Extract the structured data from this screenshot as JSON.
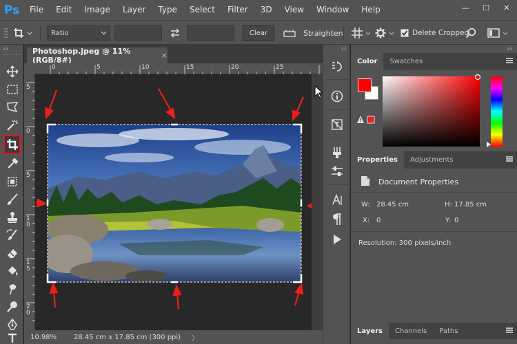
{
  "app": {
    "logo": "Ps"
  },
  "menu": [
    "File",
    "Edit",
    "Image",
    "Layer",
    "Type",
    "Select",
    "Filter",
    "3D",
    "View",
    "Window",
    "Help"
  ],
  "window_controls": {
    "minimize": "—",
    "maximize": "☐",
    "close": "✕"
  },
  "options_bar": {
    "ratio_label": "Ratio",
    "clear_label": "Clear",
    "straighten_label": "Straighten",
    "delete_cropped_label": "Delete Cropped",
    "delete_cropped_checked": true
  },
  "document": {
    "tab_title": "Photoshop.jpeg @ 11% (RGB/8#)",
    "tab_close": "×",
    "ruler_h_labels": [
      "0",
      "5",
      "10",
      "15",
      "20",
      "25"
    ],
    "ruler_v_labels": [
      "5",
      "0",
      "5",
      "1 0",
      "1 5",
      "2 0"
    ]
  },
  "status": {
    "zoom": "10.98%",
    "doc_info": "28.45 cm x 17.85 cm (300 ppi)",
    "arrow": "〉"
  },
  "color_panel": {
    "tabs": [
      "Color",
      "Swatches"
    ],
    "active_tab": "Color",
    "foreground": "#ff0000",
    "background": "#ffffff"
  },
  "properties_panel": {
    "tabs": [
      "Properties",
      "Adjustments"
    ],
    "active_tab": "Properties",
    "title": "Document Properties",
    "w_label": "W:",
    "w_value": "28.45 cm",
    "h_label": "H:",
    "h_value": "17.85 cm",
    "x_label": "X:",
    "x_value": "0",
    "y_label": "Y:",
    "y_value": "0",
    "resolution": "Resolution: 300 pixels/inch"
  },
  "layers_panel": {
    "tabs": [
      "Layers",
      "Channels",
      "Paths"
    ],
    "active_tab": "Layers"
  },
  "colors": {
    "accent_red": "#e8201a",
    "ps_blue": "#2fa3f5"
  }
}
